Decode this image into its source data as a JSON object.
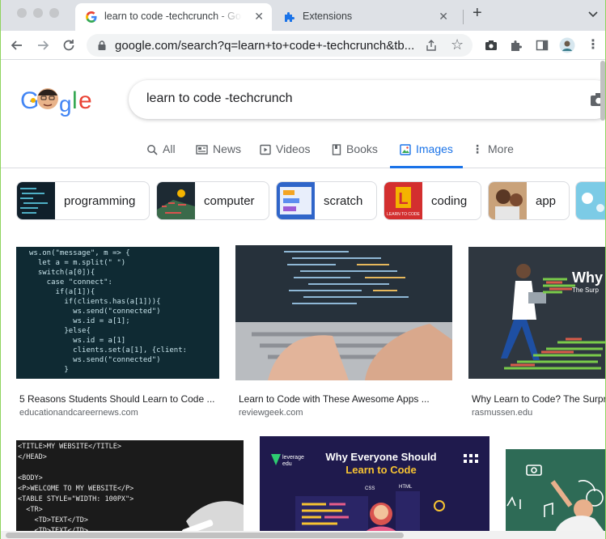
{
  "browser": {
    "tabs": [
      {
        "title": "learn to code -techcrunch - Google Search",
        "active": true
      },
      {
        "title": "Extensions",
        "active": false
      }
    ],
    "url": "google.com/search?q=learn+to+code+-techcrunch&tb..."
  },
  "search": {
    "query": "learn to code -techcrunch",
    "nav": [
      {
        "label": "All",
        "icon": "search-icon"
      },
      {
        "label": "News",
        "icon": "news-icon"
      },
      {
        "label": "Videos",
        "icon": "video-icon"
      },
      {
        "label": "Books",
        "icon": "book-icon"
      },
      {
        "label": "Images",
        "icon": "image-icon",
        "active": true
      },
      {
        "label": "More",
        "icon": "more-vert-icon"
      }
    ]
  },
  "chips": [
    "programming",
    "computer",
    "scratch",
    "coding",
    "app"
  ],
  "results": [
    {
      "caption": "5 Reasons Students Should Learn to Code ...",
      "source": "educationandcareernews.com"
    },
    {
      "caption": "Learn to Code with These Awesome Apps ...",
      "source": "reviewgeek.com"
    },
    {
      "caption": "Why Learn to Code? The Surprising...",
      "source": "rasmussen.edu"
    },
    {
      "caption": "",
      "source": ""
    },
    {
      "caption": "",
      "source": ""
    },
    {
      "caption": "",
      "source": ""
    }
  ],
  "image_text": {
    "code_screen": "ws.on(\"message\", m => {\n  let a = m.split(\" \")\n  switch(a[0]){\n    case \"connect\":\n      if(a[1]){\n        if(clients.has(a[1])){\n          ws.send(\"connected\")\n          ws.id = a[1];\n        }else{\n          ws.id = a[1]\n          clients.set(a[1], {client:\n          ws.send(\"connected\")\n        }",
    "html_paper": "<TITLE>MY WEBSITE</TITLE>\n</HEAD>\n\n<BODY>\n<P>WELCOME TO MY WEBSITE</P>\n<TABLE STYLE=\"WIDTH: 100PX\">\n  <TR>\n    <TD>TEXT</TD>\n    <TD>TEXT</TD>",
    "rasmussen_title": "Why",
    "rasmussen_sub": "The Surp",
    "leverage_brand": "leverage\nedu",
    "leverage_headline_1": "Why Everyone Should",
    "leverage_headline_2": "Learn to Code",
    "css_label": "CSS",
    "html_label": "HTML",
    "coding_badge": "L",
    "coding_sub": "LEARN TO CODE"
  },
  "colors": {
    "accent": "#1a73e8",
    "tabstrip": "#dee1e6",
    "leverage_bg": "#1f1a4d",
    "leverage_yellow": "#f7c332"
  }
}
